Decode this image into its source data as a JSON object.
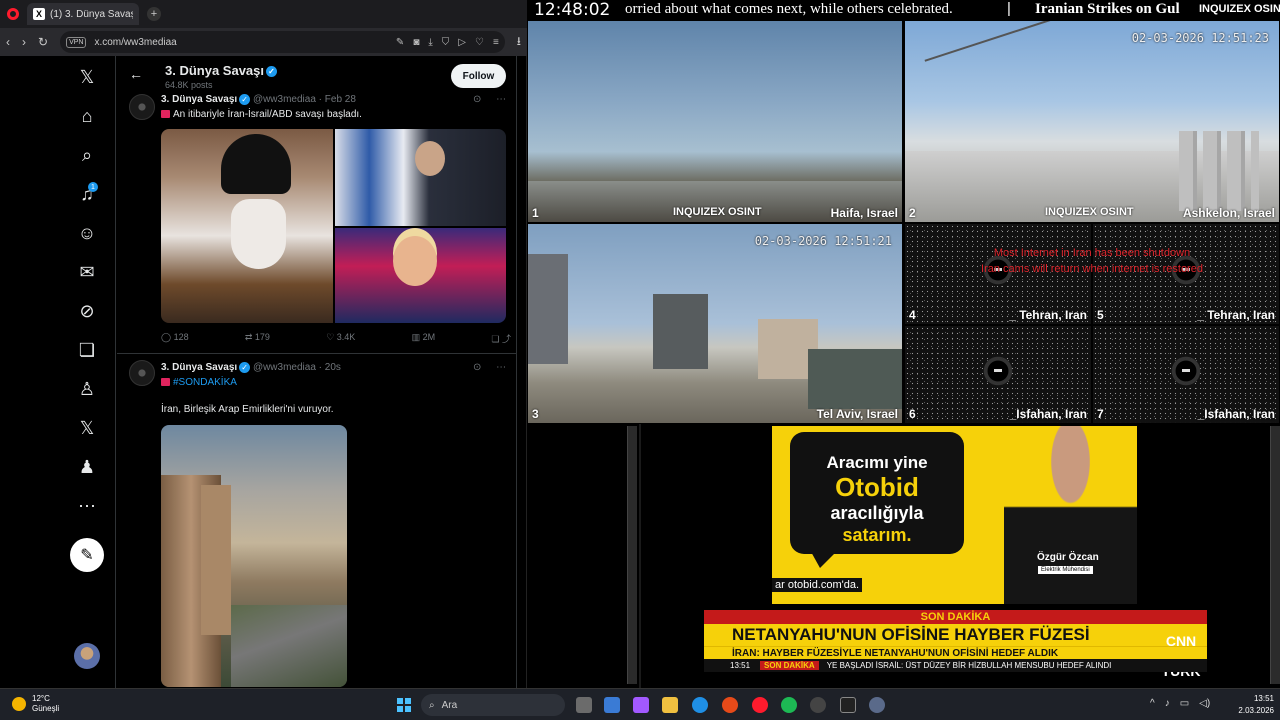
{
  "browser": {
    "tab_title": "(1) 3. Dünya Savaşı (@ww...",
    "new_tab": "+",
    "vpn": "VPN",
    "url": "x.com/ww3mediaa"
  },
  "profile": {
    "name": "3. Dünya Savaşı",
    "posts": "64.8K posts",
    "follow_label": "Follow"
  },
  "sidebar": {
    "notification_count": "1",
    "items": [
      "x-logo",
      "home",
      "explore",
      "notifications",
      "follow",
      "messages",
      "grok",
      "bookmarks",
      "jobs",
      "premium",
      "profile",
      "more"
    ]
  },
  "tweets": [
    {
      "name": "3. Dünya Savaşı",
      "handle": "@ww3mediaa · Feb 28",
      "text": "An itibariyle İran-İsrail/ABD savaşı başladı.",
      "replies": "128",
      "reposts": "179",
      "likes": "3.4K",
      "views": "2M"
    },
    {
      "name": "3. Dünya Savaşı",
      "handle": "@ww3mediaa · 20s",
      "hashtag": "#SONDAKİKA",
      "text": "İran, Birleşik Arap Emirlikleri'ni vuruyor."
    }
  ],
  "stream": {
    "clock": "12:48:02",
    "ticker": "orried about what comes next, while others celebrated.",
    "ticker_sep": "|",
    "ticker2": "Iranian Strikes on Gul",
    "brand": "INQUIZEX OSINT",
    "cams": [
      {
        "num": "1",
        "loc": "Haifa, Israel"
      },
      {
        "num": "2",
        "loc": "Ashkelon, Israel",
        "ts": "02-03-2026 12:51:23"
      },
      {
        "num": "3",
        "loc": "Tel Aviv, Israel",
        "ts": "02-03-2026 12:51:21"
      },
      {
        "num": "4",
        "loc": "_ Tehran, Iran"
      },
      {
        "num": "5",
        "loc": "_ Tehran, Iran"
      },
      {
        "num": "6",
        "loc": "_Isfahan, Iran"
      },
      {
        "num": "7",
        "loc": "_Isfahan, Iran"
      }
    ],
    "iran_msg_1": "Most Internet in Iran has been shutdown",
    "iran_msg_2": "Iran cams will return when internet is restored"
  },
  "ad": {
    "line1": "Aracımı yine",
    "line2": "Otobid",
    "line3": "aracılığıyla",
    "line4": "satarım.",
    "person": "Özgür Özcan",
    "role": "Elektrik Mühendisi",
    "url": "ar otobid.com'da."
  },
  "cnn": {
    "band": "SON DAKİKA",
    "headline": "NETANYAHU'NUN OFİSİNE HAYBER FÜZESİ",
    "sub": "İRAN: HAYBER FÜZESİYLE NETANYAHU'NUN OFİSİNİ HEDEF ALDIK",
    "logo": "CNN TÜRK",
    "bottom_time": "13:51",
    "bottom_sd": "SON DAKİKA",
    "bottom_text": "YE BAŞLADI     İSRAİL: ÜST DÜZEY BİR HİZBULLAH MENSUBU HEDEF ALINDI"
  },
  "taskbar": {
    "temp": "12°C",
    "weather": "Güneşli",
    "search_placeholder": "Ara",
    "time": "13:51",
    "date": "2.03.2026"
  }
}
